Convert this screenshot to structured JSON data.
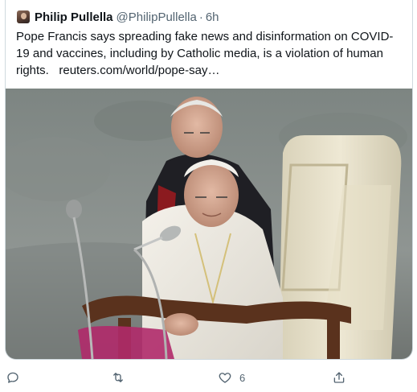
{
  "tweet": {
    "author_name": "Philip Pullella",
    "author_handle": "@PhilipPullella",
    "separator": "·",
    "timestamp": "6h",
    "text": "Pope Francis says spreading fake news and disinformation on COVID-19 and vaccines, including by Catholic media, is a violation of human rights.",
    "link_text": "reuters.com/world/pope-say…",
    "likes": "6"
  },
  "icons": {
    "avatar": "author-avatar",
    "reply": "reply-icon",
    "retweet": "retweet-icon",
    "like": "heart-icon",
    "share": "share-icon"
  },
  "colors": {
    "text": "#0f1419",
    "secondary": "#536471",
    "border": "#cfd9de"
  }
}
